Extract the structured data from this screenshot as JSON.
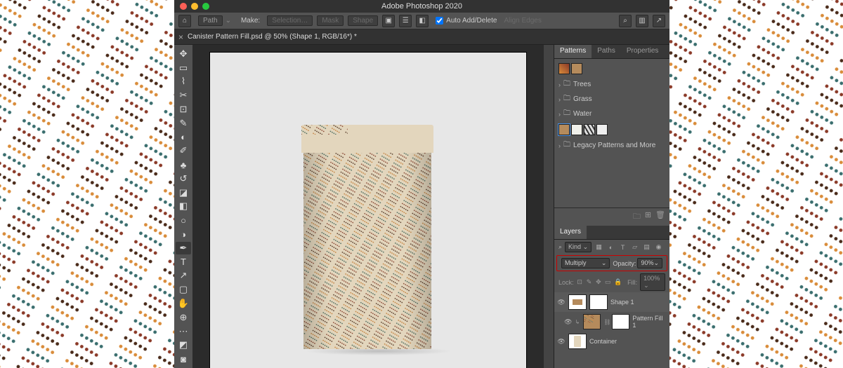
{
  "app_title": "Adobe Photoshop 2020",
  "options_bar": {
    "path_label": "Path",
    "make_label": "Make:",
    "selection_btn": "Selection…",
    "mask_btn": "Mask",
    "shape_btn": "Shape",
    "auto_add_delete": "Auto Add/Delete",
    "align_edges": "Align Edges"
  },
  "document_tab": "Canister Pattern Fill.psd @ 50% (Shape 1, RGB/16*) *",
  "tools": [
    "↖",
    "▭",
    "⊡",
    "✂",
    "✎",
    "◧",
    "⟋",
    "✐",
    "⌁",
    "⟳",
    "⊘",
    "◻",
    "◦",
    "✎",
    "△",
    "T",
    "↗",
    "□",
    "✋",
    "⊕",
    "…",
    "⬚",
    "⬓"
  ],
  "panel_tabs": {
    "patterns": "Patterns",
    "paths": "Paths",
    "properties": "Properties"
  },
  "pattern_folders": [
    "Trees",
    "Grass",
    "Water"
  ],
  "pattern_legacy": "Legacy Patterns and More",
  "layers_tab": "Layers",
  "filter": {
    "kind": "Kind"
  },
  "blend": {
    "mode": "Multiply",
    "opacity_label": "Opacity:",
    "opacity_value": "90%"
  },
  "lock": {
    "label": "Lock:",
    "fill_label": "Fill:",
    "fill_value": "100%"
  },
  "layers": [
    {
      "name": "Shape 1"
    },
    {
      "name": "Pattern Fill 1"
    },
    {
      "name": "Container"
    }
  ],
  "colors": {
    "pat1": "#d98c3a",
    "pat2": "#3a6e6e",
    "pat3": "#8b3a28",
    "pat4": "#4a2b1a"
  }
}
